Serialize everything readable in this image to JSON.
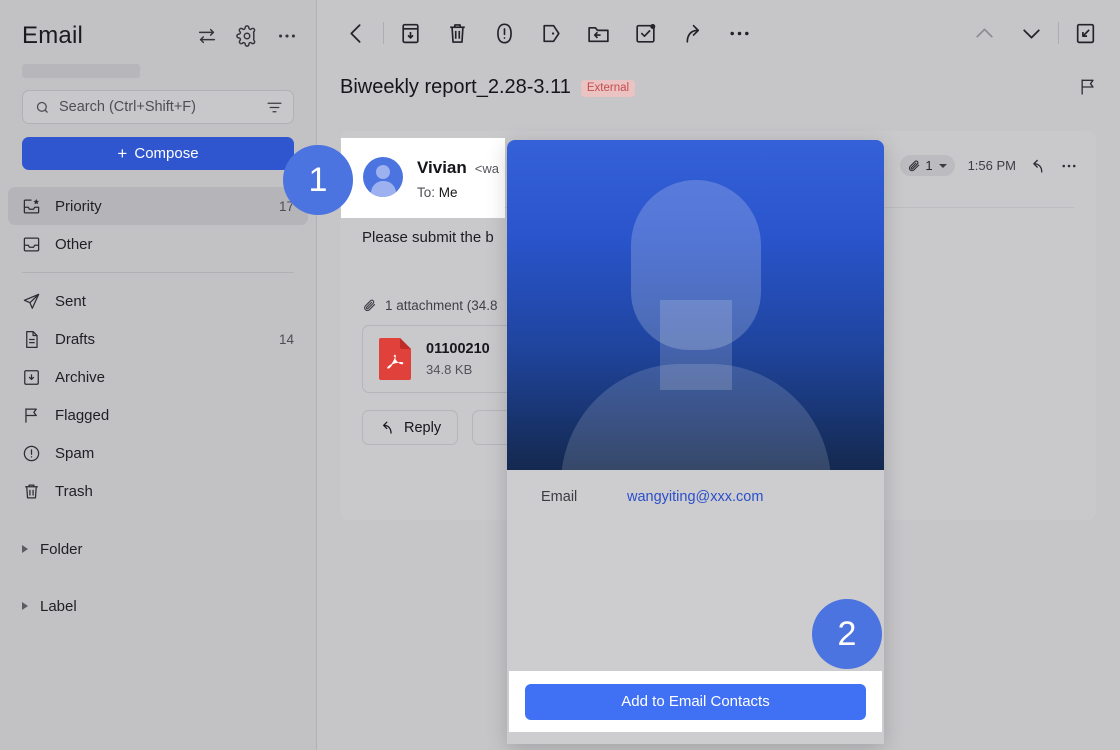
{
  "sidebar": {
    "title": "Email",
    "header_icons": [
      {
        "name": "switch-arrows-icon"
      },
      {
        "name": "gear-icon"
      },
      {
        "name": "more-horizontal-icon"
      }
    ],
    "search": {
      "placeholder": "Search (Ctrl+Shift+F)",
      "value": ""
    },
    "compose_label": "Compose",
    "items": [
      {
        "label": "Priority",
        "count": "17",
        "icon": "inbox-star-icon",
        "active": true
      },
      {
        "label": "Other",
        "count": "",
        "icon": "inbox-icon",
        "active": false
      },
      {
        "label": "Sent",
        "count": "",
        "icon": "paper-plane-icon",
        "active": false
      },
      {
        "label": "Drafts",
        "count": "14",
        "icon": "document-icon",
        "active": false
      },
      {
        "label": "Archive",
        "count": "",
        "icon": "archive-box-icon",
        "active": false
      },
      {
        "label": "Flagged",
        "count": "",
        "icon": "flag-icon",
        "active": false
      },
      {
        "label": "Spam",
        "count": "",
        "icon": "exclamation-circle-icon",
        "active": false
      },
      {
        "label": "Trash",
        "count": "",
        "icon": "trash-icon",
        "active": false
      }
    ],
    "groups": [
      {
        "label": "Folder"
      },
      {
        "label": "Label"
      }
    ]
  },
  "toolbar": {
    "back": "back-arrow-icon",
    "buttons": [
      "archive-icon",
      "delete-icon",
      "report-spam-icon",
      "snooze-icon",
      "move-to-icon",
      "mark-read-icon",
      "forward-icon",
      "more-horizontal-icon"
    ],
    "prev": "chevron-up-icon",
    "next": "chevron-down-icon",
    "popout": "popout-icon"
  },
  "email": {
    "subject": "Biweekly report_2.28-3.11",
    "external_badge": "External",
    "flag_icon": "flag-icon",
    "sender_name": "Vivian",
    "sender_address": "<wa",
    "to_label": "To:",
    "to_value": "Me",
    "attachment_count": "1",
    "time": "1:56 PM",
    "reply_icon": "reply-icon",
    "more_icon": "more-horizontal-icon",
    "body": "Please submit the b",
    "attachment_summary": "1 attachment (34.8",
    "attachment_name": "01100210",
    "attachment_size": "34.8 KB",
    "actions": [
      {
        "label": "Reply",
        "icon": "reply-icon"
      },
      {
        "label": "",
        "icon": "forward-icon"
      }
    ]
  },
  "popup": {
    "email_key": "Email",
    "email_value": "wangyiting@xxx.com",
    "cta_label": "Add to Email Contacts",
    "avatar_icon": "person-silhouette-icon"
  },
  "steps": [
    {
      "number": "1"
    },
    {
      "number": "2"
    }
  ],
  "colors": {
    "accent": "#2f55cf",
    "cta": "#4070f4",
    "step_badge": "#4c74e0",
    "link": "#2b4fc9",
    "external_badge_text": "#c24d4d",
    "external_badge_bg": "#ecc3c3",
    "background": "#c6c6c9"
  }
}
